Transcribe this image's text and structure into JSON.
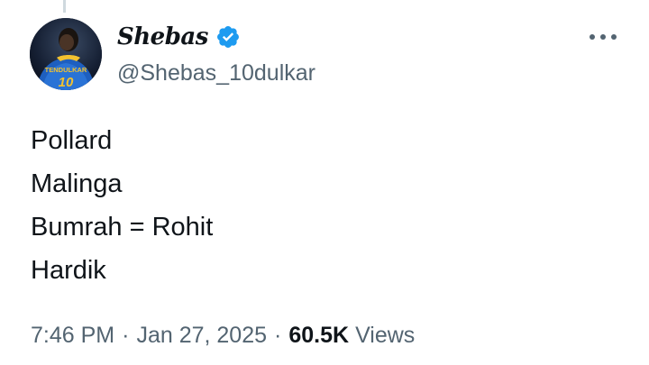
{
  "author": {
    "display_name": "Shebas",
    "handle": "@Shebas_10dulkar",
    "verified": true,
    "avatar": {
      "jersey_name": "TENDULKAR",
      "jersey_number": "10"
    }
  },
  "tweet": {
    "lines": [
      "Pollard",
      "Malinga",
      "Bumrah = Rohit",
      "Hardik"
    ]
  },
  "meta": {
    "time": "7:46 PM",
    "separator": "·",
    "date": "Jan 27, 2025",
    "views_count": "60.5K",
    "views_label": "Views"
  },
  "colors": {
    "verified_badge": "#1d9bf0",
    "secondary_text": "#536471",
    "primary_text": "#0f1419"
  },
  "icons": {
    "verified": "verified-badge-icon",
    "more": "more-horizontal-icon"
  }
}
